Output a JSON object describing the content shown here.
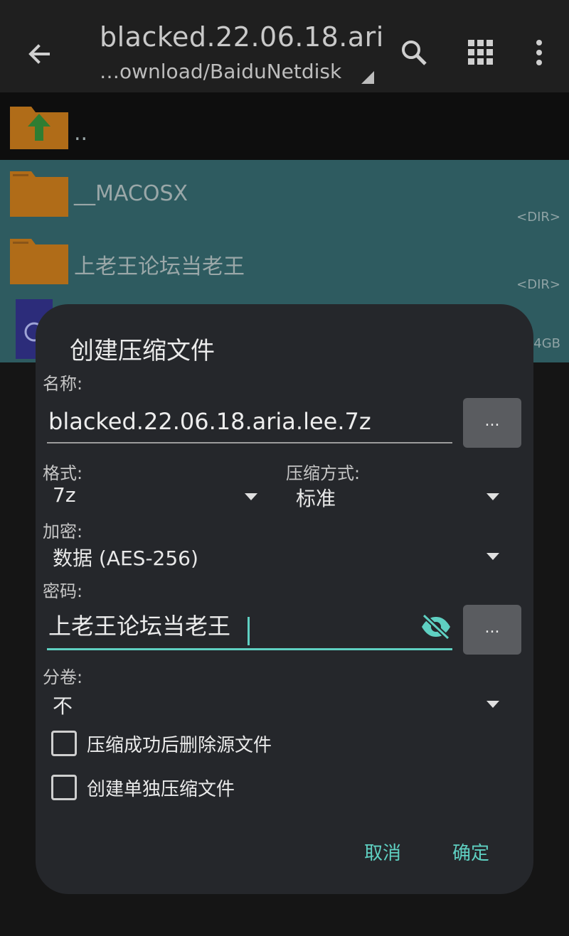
{
  "header": {
    "title": "blacked.22.06.18.ari…",
    "path": "…ownload/BaiduNetdisk"
  },
  "files": [
    {
      "name": "..",
      "meta": ""
    },
    {
      "name": "__MACOSX",
      "meta": "<DIR>"
    },
    {
      "name": "上老王论坛当老王",
      "meta": "<DIR>"
    },
    {
      "name": "",
      "meta": "4GB"
    }
  ],
  "dialog": {
    "title": "创建压缩文件",
    "name_label": "名称:",
    "name_value": "blacked.22.06.18.aria.lee.7z",
    "browse_label": "...",
    "format_label": "格式:",
    "format_value": "7z",
    "method_label": "压缩方式:",
    "method_value": "标准",
    "encryption_label": "加密:",
    "encryption_value": "数据 (AES-256)",
    "password_label": "密码:",
    "password_value": "上老王论坛当老王",
    "password_more": "...",
    "split_label": "分卷:",
    "split_value": "不",
    "delete_after_label": "压缩成功后删除源文件",
    "delete_after_checked": false,
    "separate_archives_label": "创建单独压缩文件",
    "separate_archives_checked": false,
    "cancel_label": "取消",
    "ok_label": "确定"
  },
  "colors": {
    "accent": "#5fd0c2",
    "selection": "#2e5b60",
    "dialog_bg": "#25272b",
    "folder": "#c27a1c"
  }
}
